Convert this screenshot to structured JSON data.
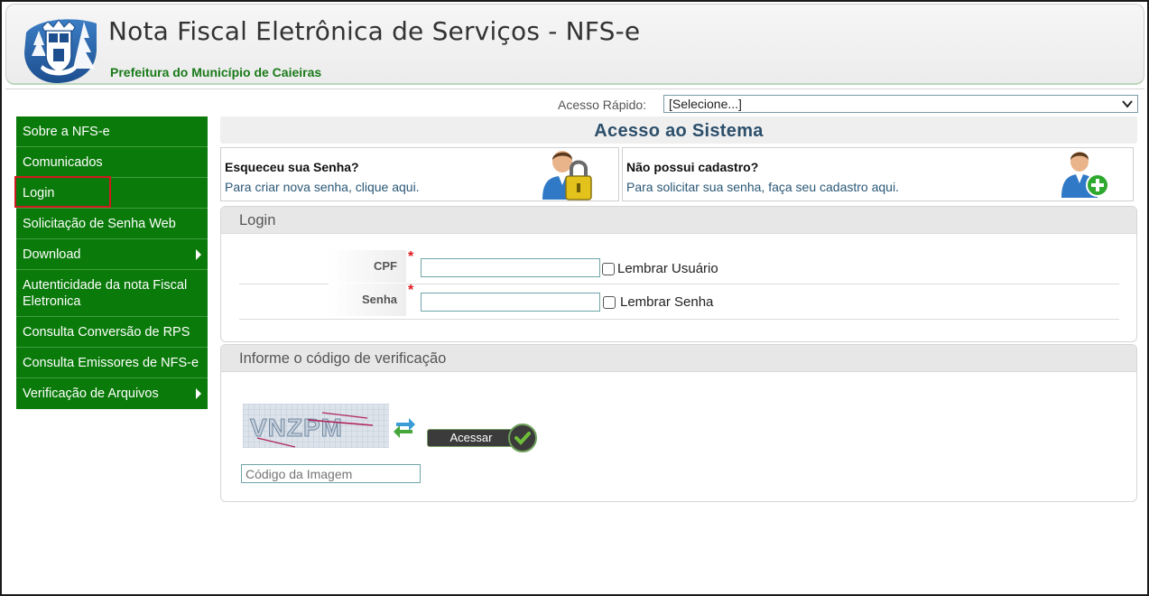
{
  "header": {
    "title": "Nota Fiscal Eletrônica de Serviços - NFS-e",
    "subtitle": "Prefeitura do Município de Caieiras"
  },
  "quick_access": {
    "label": "Acesso Rápido:",
    "selected": "[Selecione...]"
  },
  "sidebar": {
    "items": [
      {
        "label": "Sobre a NFS-e",
        "has_submenu": false
      },
      {
        "label": "Comunicados",
        "has_submenu": false
      },
      {
        "label": "Login",
        "has_submenu": false,
        "highlighted": true
      },
      {
        "label": "Solicitação de Senha Web",
        "has_submenu": false
      },
      {
        "label": "Download",
        "has_submenu": true
      },
      {
        "label": "Autenticidade da nota Fiscal Eletronica",
        "has_submenu": false
      },
      {
        "label": "Consulta Conversão de RPS",
        "has_submenu": false
      },
      {
        "label": "Consulta Emissores de NFS-e",
        "has_submenu": false
      },
      {
        "label": "Verificação de Arquivos",
        "has_submenu": true
      }
    ]
  },
  "main": {
    "title": "Acesso ao Sistema",
    "forgot": {
      "title": "Esqueceu sua Senha?",
      "text": "Para criar nova senha, clique aqui.",
      "icon": "user-lock-icon"
    },
    "register": {
      "title": "Não possui cadastro?",
      "text": "Para solicitar sua senha, faça seu cadastro aqui.",
      "icon": "user-add-icon"
    },
    "login_panel": {
      "heading": "Login",
      "cpf_label": "CPF",
      "cpf_value": "",
      "remember_user": "Lembrar Usuário",
      "password_label": "Senha",
      "password_value": "",
      "remember_password": "Lembrar Senha",
      "required_mark": "*"
    },
    "verification_panel": {
      "heading": "Informe o código de verificação",
      "captcha_text": "VNZPM",
      "captcha_placeholder": "Código da Imagem",
      "submit_label": "Acessar"
    }
  },
  "colors": {
    "sidebar_green": "#0a7a0a",
    "title_blue": "#2c4f6b",
    "subtitle_green": "#1a7a1a",
    "required_red": "#e0191f",
    "highlight_red": "#d0191f"
  }
}
